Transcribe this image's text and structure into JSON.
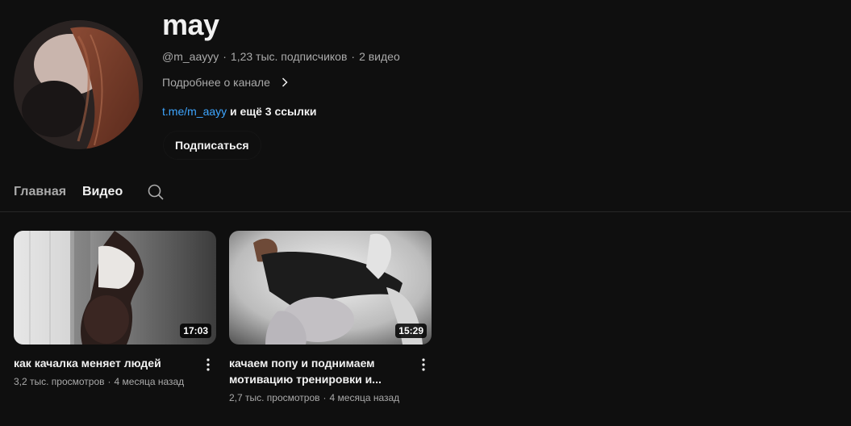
{
  "channel": {
    "name": "may",
    "handle": "@m_aayyy",
    "subscribers": "1,23 тыс. подписчиков",
    "videos_count": "2 видео",
    "about_label": "Подробнее о канале",
    "link": "t.me/m_aayy",
    "more_links": " и ещё 3 ссылки",
    "subscribe_label": "Подписаться"
  },
  "tabs": {
    "home": "Главная",
    "videos": "Видео"
  },
  "videos": [
    {
      "title": "как качалка меняет людей",
      "duration": "17:03",
      "views": "3,2 тыс. просмотров",
      "age": "4 месяца назад"
    },
    {
      "title": "качаем попу и поднимаем мотивацию тренировки и...",
      "duration": "15:29",
      "views": "2,7 тыс. просмотров",
      "age": "4 месяца назад"
    }
  ],
  "icons": {
    "about_chevron": "chevron-right-icon",
    "search": "search-icon",
    "more": "more-vert-icon"
  },
  "colors": {
    "background": "#0f0f0f",
    "link": "#3ea6ff",
    "secondary_text": "#aaaaaa"
  }
}
